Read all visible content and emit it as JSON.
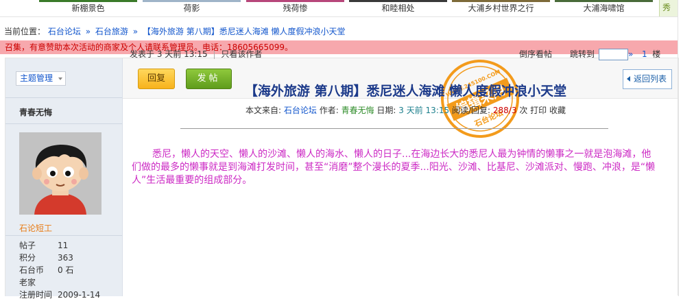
{
  "thumbnails": [
    {
      "caption": "新棚景色",
      "color": "#3b7a2a"
    },
    {
      "caption": "荷影",
      "color": "#9fb4c8"
    },
    {
      "caption": "残荷惨",
      "color": "#b7477a"
    },
    {
      "caption": "和睦相处",
      "color": "#3a3a3a"
    },
    {
      "caption": "大浦乡村世界之行",
      "color": "#7d6a3a"
    },
    {
      "caption": "大浦海啸馆",
      "color": "#4a6b3a"
    }
  ],
  "strip_end": "秀",
  "breadcrumb": {
    "prefix": "当前位置：",
    "items": [
      "石台论坛",
      "石台旅游",
      "【海外旅游 第八期】悉尼迷人海滩 懒人度假冲浪小天堂"
    ],
    "separator": "»"
  },
  "notice": "召集，有意赞助本次活动的商家及个人请联系管理员。电话：18605665099。",
  "toolbar": {
    "manage": "主题管理",
    "reply": "回复",
    "post": "发帖",
    "back": "返回列表"
  },
  "profile": {
    "username": "青春无悔",
    "rank": "石论短工",
    "stats": [
      {
        "label": "帖子",
        "value": "11"
      },
      {
        "label": "积分",
        "value": "363"
      },
      {
        "label": "石台币",
        "value": "0 石"
      },
      {
        "label": "老家",
        "value": ""
      },
      {
        "label": "注册时间",
        "value": "2009-1-14"
      }
    ]
  },
  "meta": {
    "posted_prefix": "发表于",
    "posted_time": "3 天前 13:15",
    "author_only": "只看该作者",
    "reverse": "倒序看帖",
    "goto": "跳转到",
    "goto_arrow": "»",
    "floor_num": "1",
    "floor_label": "楼"
  },
  "post": {
    "title": "【海外旅游 第八期】悉尼迷人海滩 懒人度假冲浪小天堂",
    "source_label": "本文来自:",
    "source": "石台论坛",
    "author_label": "作者:",
    "author": "青春无悔",
    "date_label": "日期:",
    "date": "3 天前 13:15",
    "views_label": "阅读/回复:",
    "views": "288/3",
    "views_unit": "次",
    "print": "打印",
    "favorite": "收藏",
    "body": "悉尼，懒人的天空、懒人的沙滩、懒人的海水、懒人的日子...在海边长大的悉尼人最为钟情的懒事之一就是泡海滩，他们做的最多的懒事就是到海滩打发时间，甚至“消磨”整个漫长的夏季...阳光、沙滩、比基尼、沙滩派对、慢跑、冲浪，是“懒人”生活最重要的组成部分。"
  },
  "stamp": {
    "url": "WWW.245100.COM",
    "center": "编辑采用",
    "bottom": "石台论坛",
    "color": "#f39b1c"
  }
}
